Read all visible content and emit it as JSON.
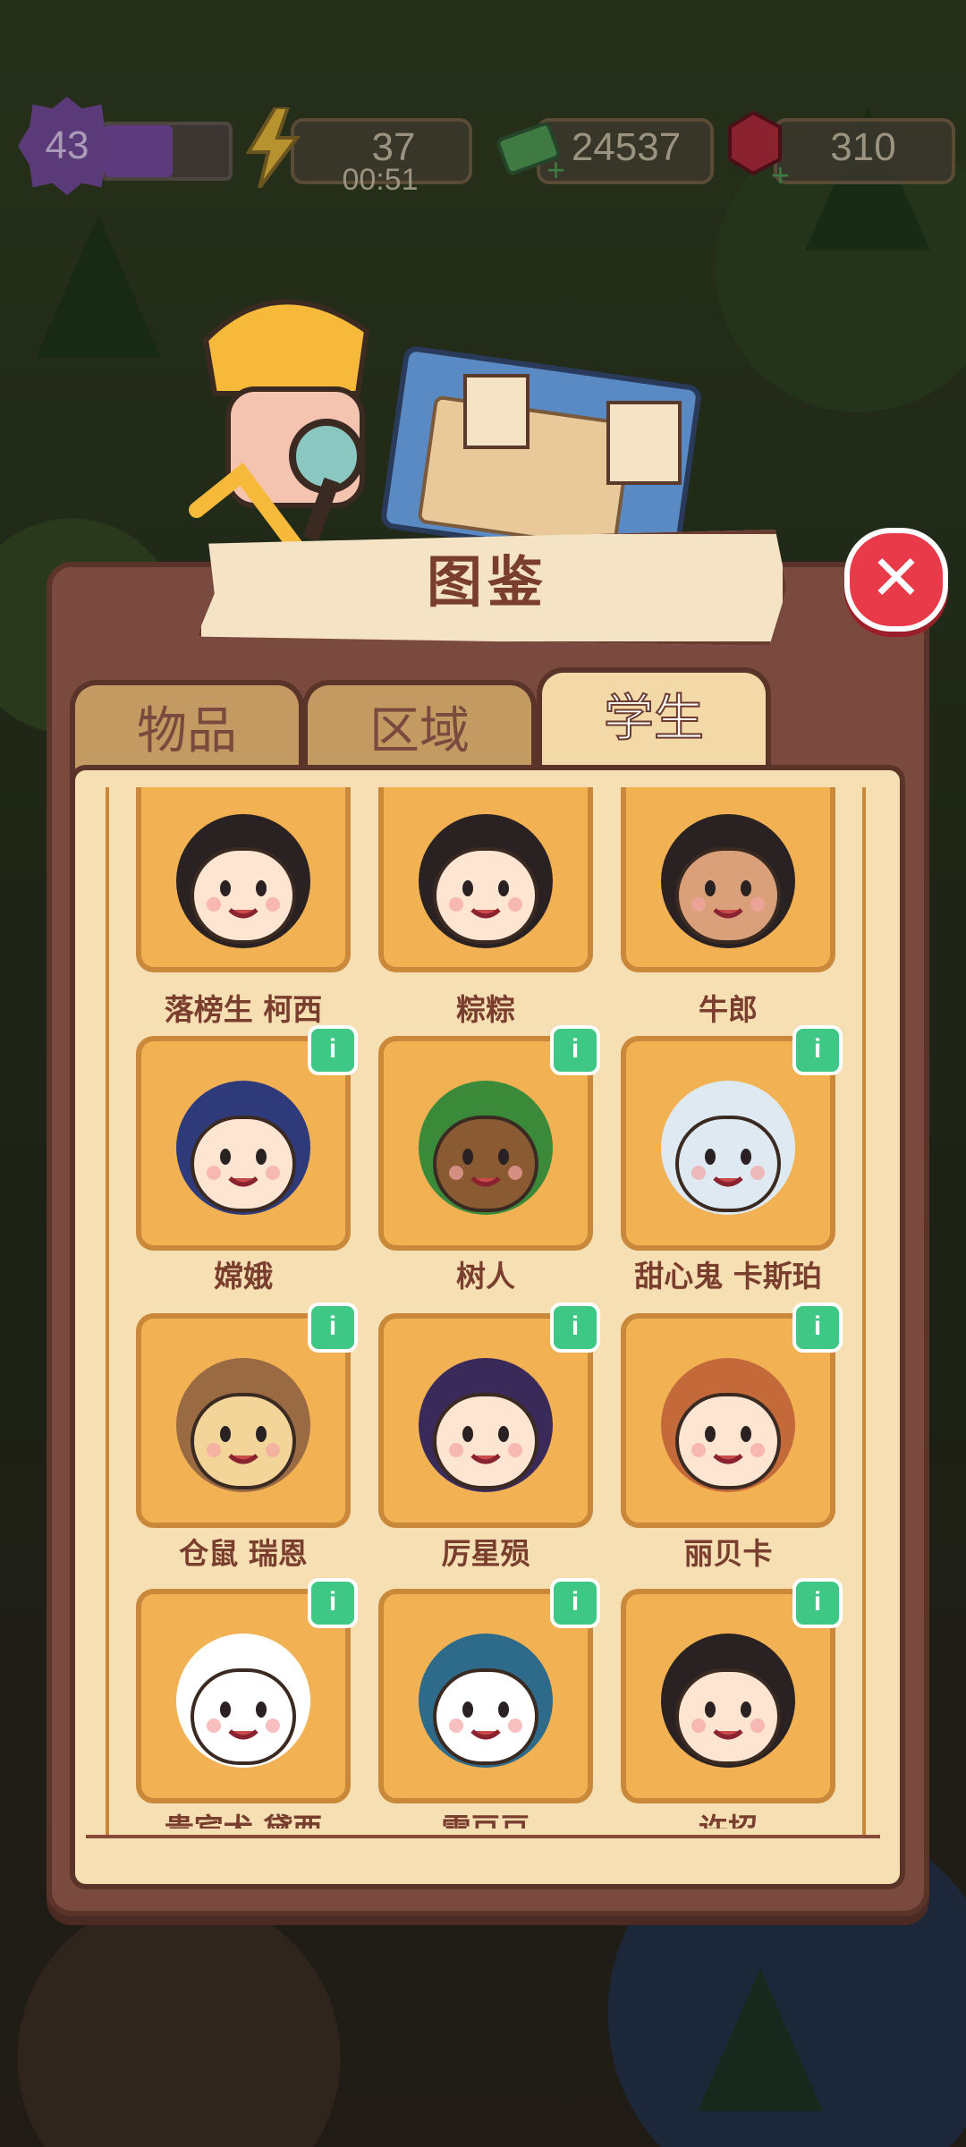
{
  "hud": {
    "level": "43",
    "xp_fill": 0.55,
    "energy": "37",
    "energy_timer": "00:51",
    "cash": "24537",
    "gems": "310"
  },
  "panel": {
    "title": "图鉴",
    "close_icon": "close-icon"
  },
  "tabs": [
    {
      "label": "物品",
      "active": false
    },
    {
      "label": "区域",
      "active": false
    },
    {
      "label": "学生",
      "active": true
    }
  ],
  "students": [
    {
      "name": "落榜生 柯西",
      "color": "#fde5d2",
      "hair": "#2a2222",
      "info": true
    },
    {
      "name": "粽粽",
      "color": "#fde5d2",
      "hair": "#2a2222",
      "info": true
    },
    {
      "name": "牛郎",
      "color": "#d9a07a",
      "hair": "#2a2222",
      "info": true
    },
    {
      "name": "嫦娥",
      "color": "#fde5d2",
      "hair": "#2e3a7a",
      "info": true
    },
    {
      "name": "树人",
      "color": "#8a5a32",
      "hair": "#3a8a3a",
      "info": true
    },
    {
      "name": "甜心鬼 卡斯珀",
      "color": "#dfe9f2",
      "hair": "#dfe9f2",
      "info": true
    },
    {
      "name": "仓鼠 瑞恩",
      "color": "#f3d59a",
      "hair": "#9a6a42",
      "info": true
    },
    {
      "name": "厉星殒",
      "color": "#fde5d2",
      "hair": "#3a2a5a",
      "info": true
    },
    {
      "name": "丽贝卡",
      "color": "#fde5d2",
      "hair": "#c46a3a",
      "info": true
    },
    {
      "name": "贵宾犬 黛西",
      "color": "#ffffff",
      "hair": "#ffffff",
      "info": true
    },
    {
      "name": "雪豆豆",
      "color": "#ffffff",
      "hair": "#2e6a8a",
      "info": true
    },
    {
      "name": "许招",
      "color": "#fde5d2",
      "hair": "#2a2222",
      "info": true
    }
  ]
}
